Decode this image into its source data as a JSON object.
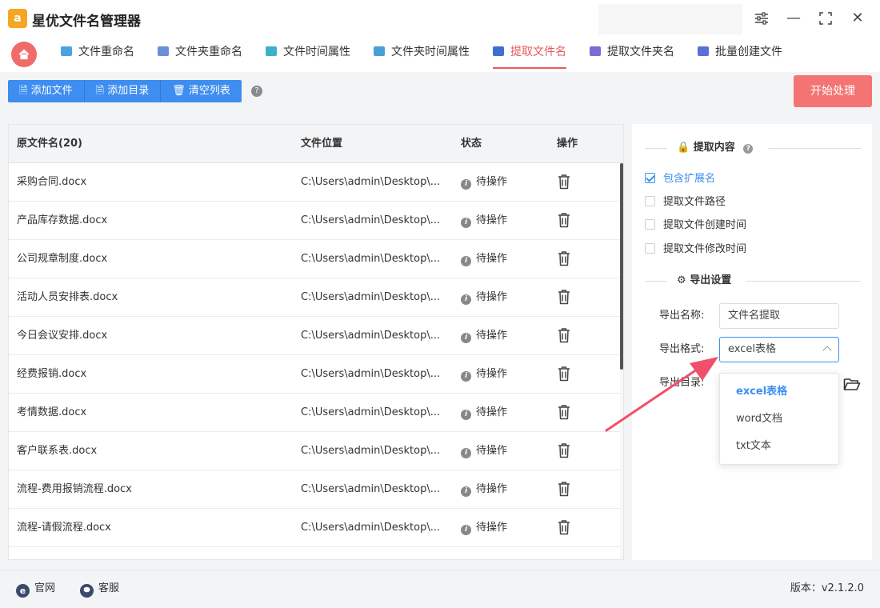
{
  "app": {
    "logo_text": "a",
    "title": "星优文件名管理器"
  },
  "window_controls": {
    "settings_icon": "sliders-icon",
    "minimize": "—",
    "maximize": "⛶",
    "close": "✕"
  },
  "tabs": [
    {
      "label": "文件重命名",
      "icon_color": "#4aa3df"
    },
    {
      "label": "文件夹重命名",
      "icon_color": "#6b8fd6"
    },
    {
      "label": "文件时间属性",
      "icon_color": "#3ab0c9"
    },
    {
      "label": "文件夹时间属性",
      "icon_color": "#4a9ed8"
    },
    {
      "label": "提取文件名",
      "icon_color": "#3d6fd0",
      "active": true
    },
    {
      "label": "提取文件夹名",
      "icon_color": "#7a6bd6"
    },
    {
      "label": "批量创建文件",
      "icon_color": "#5a6fd8"
    }
  ],
  "toolbar": {
    "add_file": "添加文件",
    "add_dir": "添加目录",
    "clear_list": "清空列表",
    "help": "?",
    "start": "开始处理"
  },
  "table": {
    "headers": {
      "name": "原文件名(20)",
      "path": "文件位置",
      "status": "状态",
      "action": "操作"
    },
    "rows": [
      {
        "name": "采购合同.docx",
        "path": "C:\\Users\\admin\\Desktop\\...",
        "status": "待操作"
      },
      {
        "name": "产品库存数据.docx",
        "path": "C:\\Users\\admin\\Desktop\\...",
        "status": "待操作"
      },
      {
        "name": "公司规章制度.docx",
        "path": "C:\\Users\\admin\\Desktop\\...",
        "status": "待操作"
      },
      {
        "name": "活动人员安排表.docx",
        "path": "C:\\Users\\admin\\Desktop\\...",
        "status": "待操作"
      },
      {
        "name": "今日会议安排.docx",
        "path": "C:\\Users\\admin\\Desktop\\...",
        "status": "待操作"
      },
      {
        "name": "经费报销.docx",
        "path": "C:\\Users\\admin\\Desktop\\...",
        "status": "待操作"
      },
      {
        "name": "考情数据.docx",
        "path": "C:\\Users\\admin\\Desktop\\...",
        "status": "待操作"
      },
      {
        "name": "客户联系表.docx",
        "path": "C:\\Users\\admin\\Desktop\\...",
        "status": "待操作"
      },
      {
        "name": "流程-费用报销流程.docx",
        "path": "C:\\Users\\admin\\Desktop\\...",
        "status": "待操作"
      },
      {
        "name": "流程-请假流程.docx",
        "path": "C:\\Users\\admin\\Desktop\\...",
        "status": "待操作"
      }
    ]
  },
  "panel": {
    "extract_title": "提取内容",
    "options": [
      {
        "label": "包含扩展名",
        "checked": true
      },
      {
        "label": "提取文件路径",
        "checked": false
      },
      {
        "label": "提取文件创建时间",
        "checked": false
      },
      {
        "label": "提取文件修改时间",
        "checked": false
      }
    ],
    "export_title": "导出设置",
    "export_name_label": "导出名称:",
    "export_name_value": "文件名提取",
    "export_format_label": "导出格式:",
    "export_format_value": "excel表格",
    "export_dir_label": "导出目录:",
    "format_options": [
      "excel表格",
      "word文档",
      "txt文本"
    ]
  },
  "footer": {
    "website": "官网",
    "website_icon": "e",
    "support": "客服",
    "version": "版本：v2.1.2.0"
  },
  "colors": {
    "accent": "#3d8ef0",
    "active_tab": "#e85a5a",
    "start_button": "#f47474",
    "arrow": "#f0506a"
  }
}
